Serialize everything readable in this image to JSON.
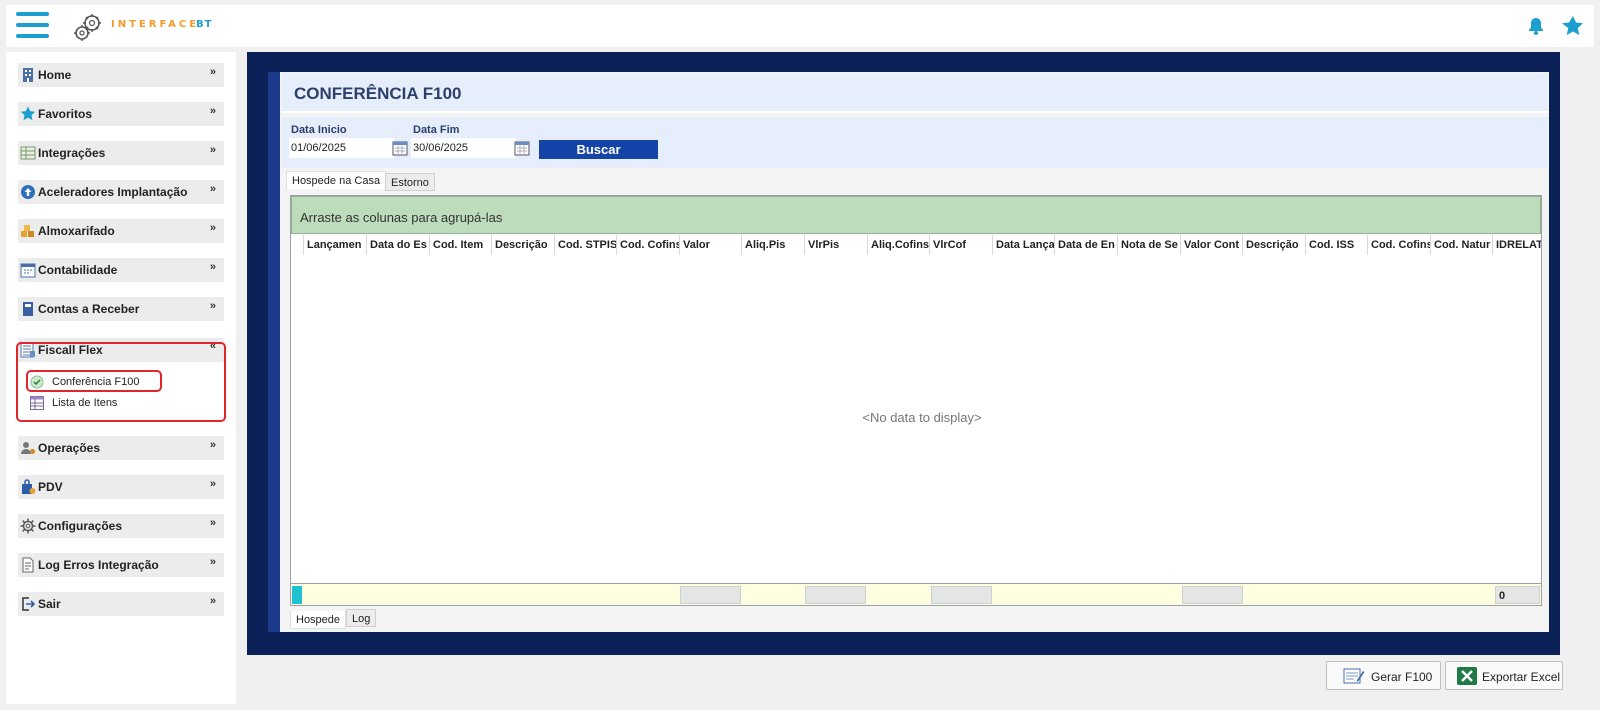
{
  "header": {
    "logo_text": "INTERFACE",
    "logo_suffix": "BT"
  },
  "sidebar": {
    "items": [
      {
        "label": "Home",
        "icon": "building-icon"
      },
      {
        "label": "Favoritos",
        "icon": "star-icon"
      },
      {
        "label": "Integrações",
        "icon": "grid-icon"
      },
      {
        "label": "Aceleradores Implantação",
        "icon": "arrow-up-circle-icon"
      },
      {
        "label": "Almoxarifado",
        "icon": "boxes-icon"
      },
      {
        "label": "Contabilidade",
        "icon": "calendar-icon"
      },
      {
        "label": "Contas a Receber",
        "icon": "notebook-icon"
      },
      {
        "label": "Fiscall Flex",
        "icon": "spreadsheet-icon",
        "expanded": true
      },
      {
        "label": "Operações",
        "icon": "user-gear-icon"
      },
      {
        "label": "PDV",
        "icon": "bag-icon"
      },
      {
        "label": "Configurações",
        "icon": "gear-icon"
      },
      {
        "label": "Log Erros Integração",
        "icon": "document-icon"
      },
      {
        "label": "Sair",
        "icon": "exit-icon"
      }
    ],
    "fiscall_sub": [
      {
        "label": "Conferência F100",
        "icon": "check-circle-icon",
        "selected": true
      },
      {
        "label": "Lista de Itens",
        "icon": "list-table-icon"
      }
    ]
  },
  "page": {
    "title": "CONFERÊNCIA F100",
    "data_inicio_label": "Data Inicio",
    "data_inicio_value": "01/06/2025",
    "data_fim_label": "Data Fim",
    "data_fim_value": "30/06/2025",
    "buscar_label": "Buscar",
    "tabs": [
      "Hospede na Casa",
      "Estorno"
    ],
    "group_panel_text": "Arraste as colunas para agrupá-las",
    "columns": [
      "Lançamen",
      "Data do Es",
      "Cod. Item",
      "Descrição",
      "Cod. STPIS",
      "Cod. Cofins",
      "Valor",
      "Aliq.Pis",
      "VlrPis",
      "Aliq.Cofins",
      "VlrCof",
      "Data Lança",
      "Data de En",
      "Nota de Se",
      "Valor Cont",
      "Descrição",
      "Cod. ISS",
      "Cod. Cofins",
      "Cod. Natur",
      "IDRELAT"
    ],
    "no_data": "<No data to display>",
    "footer_count": "0",
    "bottom_tabs": [
      "Hospede",
      "Log"
    ]
  },
  "actions": {
    "gerar_label": "Gerar F100",
    "exportar_label": "Exportar Excel"
  },
  "colors": {
    "accent_blue": "#1d9ed0",
    "frame_navy": "#0b2158",
    "button_blue": "#1544a8",
    "group_green": "#bddcbc",
    "highlight_red": "#e0252b"
  }
}
